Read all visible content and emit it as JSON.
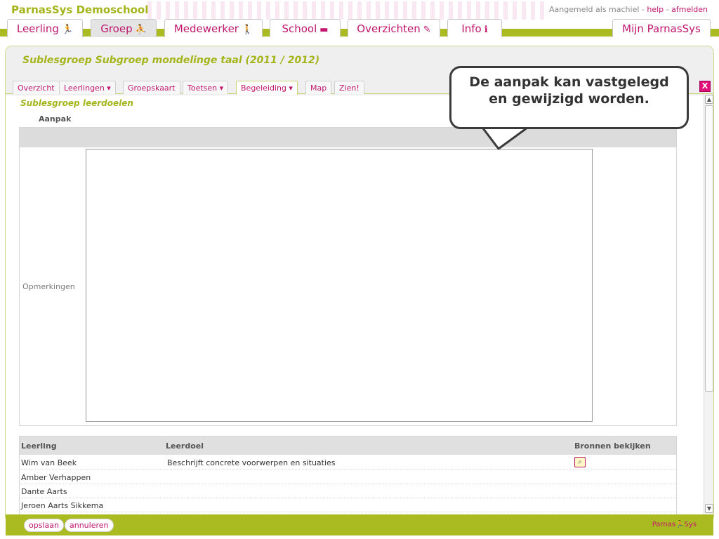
{
  "header": {
    "school_name": "ParnasSys Demoschool",
    "login_prefix": "Aangemeld als machiel - ",
    "help": "help",
    "separator": " - ",
    "logout": "afmelden"
  },
  "main_tabs": [
    {
      "label": "Leerling",
      "icon": "🏃"
    },
    {
      "label": "Groep",
      "icon": "⛹"
    },
    {
      "label": "Medewerker",
      "icon": "🚶"
    },
    {
      "label": "School",
      "icon": "▬"
    },
    {
      "label": "Overzichten",
      "icon": "✎"
    },
    {
      "label": "Info",
      "icon": "ℹ"
    },
    {
      "label": "Mijn ParnasSys",
      "icon": ""
    }
  ],
  "panel": {
    "title": "Sublesgroep Subgroep mondelinge taal (2011 / 2012)",
    "section_title": "Sublesgroep leerdoelen",
    "aanpak_label": "Aanpak",
    "opmerkingen_label": "Opmerkingen",
    "opmerkingen_value": ""
  },
  "sub_tabs": [
    {
      "label": "Overzicht"
    },
    {
      "label": "Leerlingen ▾"
    },
    {
      "label": "Groepskaart"
    },
    {
      "label": "Toetsen ▾"
    },
    {
      "label": "Begeleiding ▾"
    },
    {
      "label": "Map"
    },
    {
      "label": "Zien!"
    }
  ],
  "table": {
    "headers": [
      "Leerling",
      "Leerdoel",
      "Bronnen bekijken"
    ],
    "rows": [
      {
        "leerling": "Wim van Beek",
        "leerdoel": "Beschrijft concrete voorwerpen en situaties",
        "has_source": true
      },
      {
        "leerling": "Amber Verhappen",
        "leerdoel": "",
        "has_source": false
      },
      {
        "leerling": "Dante Aarts",
        "leerdoel": "",
        "has_source": false
      },
      {
        "leerling": "Jeroen Aarts Sikkema",
        "leerdoel": "",
        "has_source": false
      }
    ]
  },
  "footer": {
    "save": "opslaan",
    "cancel": "annuleren",
    "logo_text_left": "Parnas",
    "logo_text_right": "Sys"
  },
  "close_label": "X",
  "callout": {
    "line1": "De aanpak kan vastgelegd",
    "line2": "en gewijzigd worden."
  },
  "colors": {
    "accent_green": "#a9bb20",
    "title_green": "#a4b51b",
    "accent_magenta": "#c0166e"
  }
}
